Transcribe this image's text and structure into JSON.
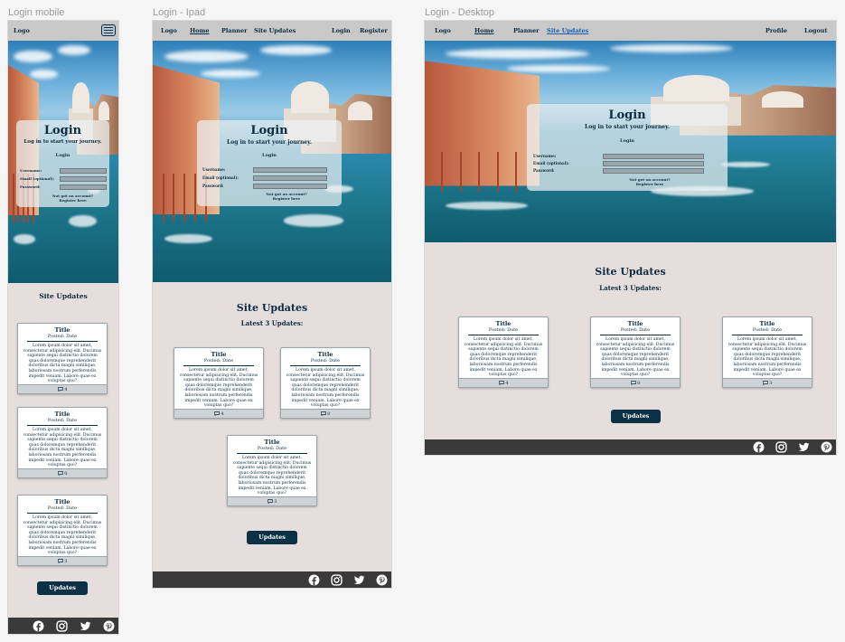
{
  "frames": [
    {
      "id": "mobile",
      "label": "Login mobile"
    },
    {
      "id": "ipad",
      "label": "Login - Ipad"
    },
    {
      "id": "desktop",
      "label": "Login - Desktop"
    }
  ],
  "nav": {
    "logo": "Logo",
    "home": "Home",
    "planner": "Planner",
    "site_updates": "Site Updates",
    "login": "Login",
    "register": "Register",
    "profile": "Profile",
    "logout": "Logout"
  },
  "login": {
    "title": "Login",
    "subtitle": "Log in to start your journey.",
    "form_heading": "Login",
    "username_label": "Username:",
    "email_label": "Email (optional):",
    "password_label": "Password:",
    "not_registered": "Not got an account?",
    "register_link": "Register here"
  },
  "updates": {
    "title": "Site Updates",
    "subtitle": "Latest 3 Updates:",
    "button": "Updates",
    "cards": [
      {
        "title": "Title",
        "date": "Posted: Date",
        "body": "Lorem ipsum dolor sit amet, consectetur adipisicing elit. Ducimus sapiente sequi distinctio dolorem quas doloremque reprehenderit doloribus dicta magni similique, laboriosam nostrum perferendis impedit veniam. Labore quae ex voluptas quo?",
        "comments": "4"
      },
      {
        "title": "Title",
        "date": "Posted: Date",
        "body": "Lorem ipsum dolor sit amet, consectetur adipisicing elit. Ducimus sapiente sequi distinctio dolorem quas doloremque reprehenderit doloribus dicta magni similique, laboriosam nostrum perferendis impedit veniam. Labore quae ex voluptas quo?",
        "comments": "0"
      },
      {
        "title": "Title",
        "date": "Posted: Date",
        "body": "Lorem ipsum dolor sit amet, consectetur adipisicing elit. Ducimus sapiente sequi distinctio dolorem quas doloremque reprehenderit doloribus dicta magni similique, laboriosam nostrum perferendis impedit veniam. Labore quae ex voluptas quo?",
        "comments": "3"
      }
    ]
  },
  "social": [
    "facebook-icon",
    "instagram-icon",
    "twitter-icon",
    "pinterest-icon"
  ],
  "colors": {
    "navy": "#0b3147",
    "nav_bg": "#c8c8c8",
    "section_bg": "#e5dedd",
    "footer_bg": "#3a3a3a"
  }
}
